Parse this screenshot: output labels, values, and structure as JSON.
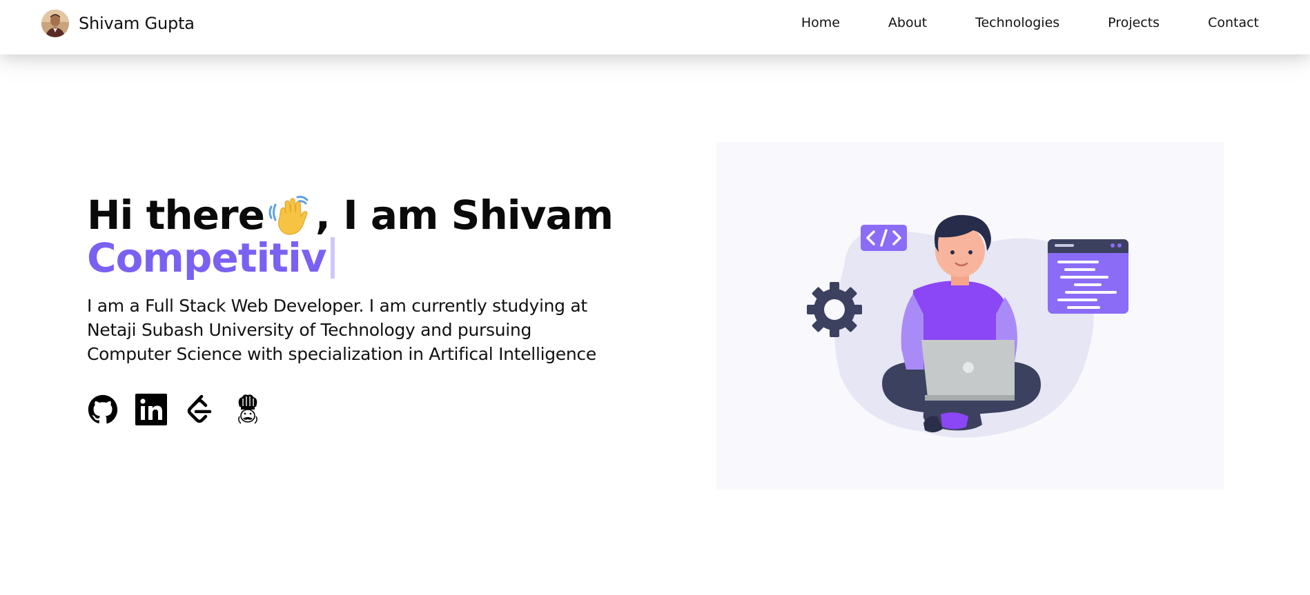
{
  "brand": {
    "name": "Shivam Gupta",
    "avatar_icon": "avatar-photo"
  },
  "nav": {
    "items": [
      {
        "label": "Home"
      },
      {
        "label": "About"
      },
      {
        "label": "Technologies"
      },
      {
        "label": "Projects"
      },
      {
        "label": "Contact"
      }
    ]
  },
  "hero": {
    "greeting_prefix": "Hi there",
    "greeting_suffix": ", I am Shivam",
    "wave_icon": "waving-hand-icon",
    "typed_text": "Competitiv",
    "bio": "I am a Full Stack Web Developer. I am currently studying at Netaji Subash University of Technology and pursuing Computer Science with specialization in Artifical Intelligence",
    "socials": [
      {
        "icon": "github-icon"
      },
      {
        "icon": "linkedin-icon"
      },
      {
        "icon": "leetcode-icon"
      },
      {
        "icon": "codechef-icon"
      }
    ],
    "illustration_icon": "developer-with-laptop-illustration"
  },
  "colors": {
    "accent": "#7b61f2",
    "cursor": "#cfc6fb",
    "text": "#111111",
    "image_bg": "#f8f8fd"
  }
}
